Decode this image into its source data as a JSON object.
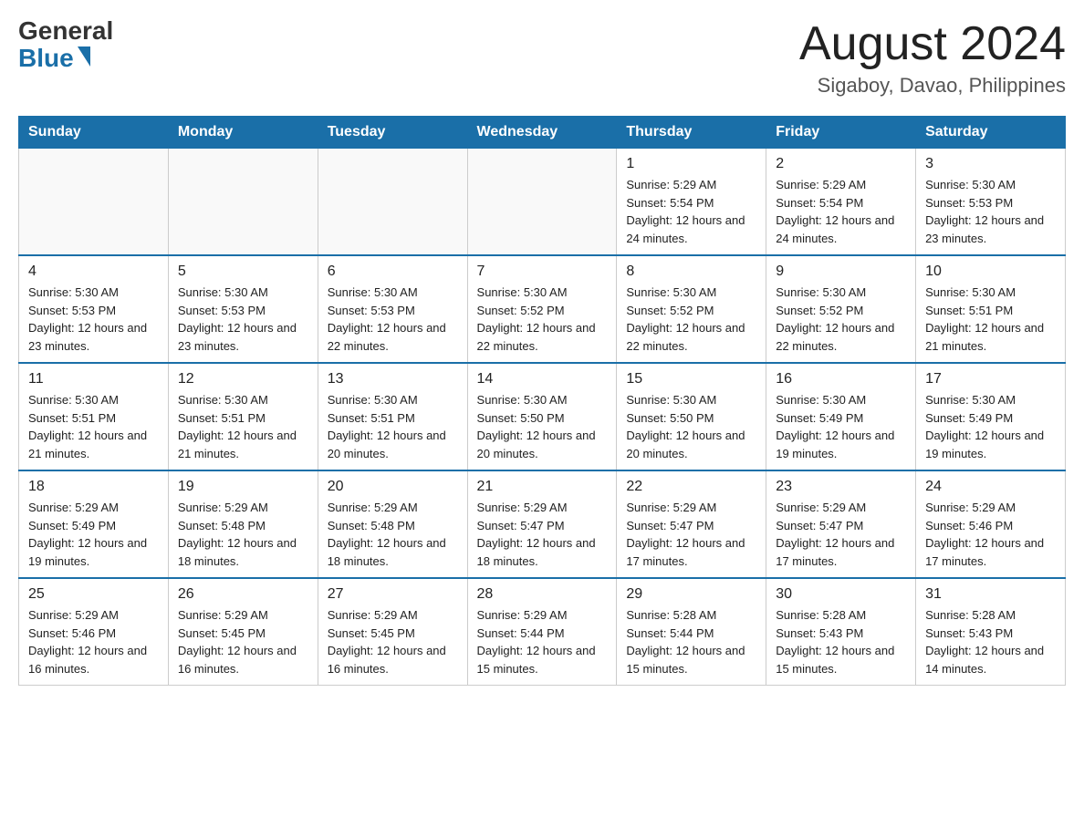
{
  "logo": {
    "general": "General",
    "blue": "Blue"
  },
  "title": {
    "month": "August 2024",
    "location": "Sigaboy, Davao, Philippines"
  },
  "weekdays": [
    "Sunday",
    "Monday",
    "Tuesday",
    "Wednesday",
    "Thursday",
    "Friday",
    "Saturday"
  ],
  "weeks": [
    [
      {
        "day": "",
        "info": ""
      },
      {
        "day": "",
        "info": ""
      },
      {
        "day": "",
        "info": ""
      },
      {
        "day": "",
        "info": ""
      },
      {
        "day": "1",
        "info": "Sunrise: 5:29 AM\nSunset: 5:54 PM\nDaylight: 12 hours and 24 minutes."
      },
      {
        "day": "2",
        "info": "Sunrise: 5:29 AM\nSunset: 5:54 PM\nDaylight: 12 hours and 24 minutes."
      },
      {
        "day": "3",
        "info": "Sunrise: 5:30 AM\nSunset: 5:53 PM\nDaylight: 12 hours and 23 minutes."
      }
    ],
    [
      {
        "day": "4",
        "info": "Sunrise: 5:30 AM\nSunset: 5:53 PM\nDaylight: 12 hours and 23 minutes."
      },
      {
        "day": "5",
        "info": "Sunrise: 5:30 AM\nSunset: 5:53 PM\nDaylight: 12 hours and 23 minutes."
      },
      {
        "day": "6",
        "info": "Sunrise: 5:30 AM\nSunset: 5:53 PM\nDaylight: 12 hours and 22 minutes."
      },
      {
        "day": "7",
        "info": "Sunrise: 5:30 AM\nSunset: 5:52 PM\nDaylight: 12 hours and 22 minutes."
      },
      {
        "day": "8",
        "info": "Sunrise: 5:30 AM\nSunset: 5:52 PM\nDaylight: 12 hours and 22 minutes."
      },
      {
        "day": "9",
        "info": "Sunrise: 5:30 AM\nSunset: 5:52 PM\nDaylight: 12 hours and 22 minutes."
      },
      {
        "day": "10",
        "info": "Sunrise: 5:30 AM\nSunset: 5:51 PM\nDaylight: 12 hours and 21 minutes."
      }
    ],
    [
      {
        "day": "11",
        "info": "Sunrise: 5:30 AM\nSunset: 5:51 PM\nDaylight: 12 hours and 21 minutes."
      },
      {
        "day": "12",
        "info": "Sunrise: 5:30 AM\nSunset: 5:51 PM\nDaylight: 12 hours and 21 minutes."
      },
      {
        "day": "13",
        "info": "Sunrise: 5:30 AM\nSunset: 5:51 PM\nDaylight: 12 hours and 20 minutes."
      },
      {
        "day": "14",
        "info": "Sunrise: 5:30 AM\nSunset: 5:50 PM\nDaylight: 12 hours and 20 minutes."
      },
      {
        "day": "15",
        "info": "Sunrise: 5:30 AM\nSunset: 5:50 PM\nDaylight: 12 hours and 20 minutes."
      },
      {
        "day": "16",
        "info": "Sunrise: 5:30 AM\nSunset: 5:49 PM\nDaylight: 12 hours and 19 minutes."
      },
      {
        "day": "17",
        "info": "Sunrise: 5:30 AM\nSunset: 5:49 PM\nDaylight: 12 hours and 19 minutes."
      }
    ],
    [
      {
        "day": "18",
        "info": "Sunrise: 5:29 AM\nSunset: 5:49 PM\nDaylight: 12 hours and 19 minutes."
      },
      {
        "day": "19",
        "info": "Sunrise: 5:29 AM\nSunset: 5:48 PM\nDaylight: 12 hours and 18 minutes."
      },
      {
        "day": "20",
        "info": "Sunrise: 5:29 AM\nSunset: 5:48 PM\nDaylight: 12 hours and 18 minutes."
      },
      {
        "day": "21",
        "info": "Sunrise: 5:29 AM\nSunset: 5:47 PM\nDaylight: 12 hours and 18 minutes."
      },
      {
        "day": "22",
        "info": "Sunrise: 5:29 AM\nSunset: 5:47 PM\nDaylight: 12 hours and 17 minutes."
      },
      {
        "day": "23",
        "info": "Sunrise: 5:29 AM\nSunset: 5:47 PM\nDaylight: 12 hours and 17 minutes."
      },
      {
        "day": "24",
        "info": "Sunrise: 5:29 AM\nSunset: 5:46 PM\nDaylight: 12 hours and 17 minutes."
      }
    ],
    [
      {
        "day": "25",
        "info": "Sunrise: 5:29 AM\nSunset: 5:46 PM\nDaylight: 12 hours and 16 minutes."
      },
      {
        "day": "26",
        "info": "Sunrise: 5:29 AM\nSunset: 5:45 PM\nDaylight: 12 hours and 16 minutes."
      },
      {
        "day": "27",
        "info": "Sunrise: 5:29 AM\nSunset: 5:45 PM\nDaylight: 12 hours and 16 minutes."
      },
      {
        "day": "28",
        "info": "Sunrise: 5:29 AM\nSunset: 5:44 PM\nDaylight: 12 hours and 15 minutes."
      },
      {
        "day": "29",
        "info": "Sunrise: 5:28 AM\nSunset: 5:44 PM\nDaylight: 12 hours and 15 minutes."
      },
      {
        "day": "30",
        "info": "Sunrise: 5:28 AM\nSunset: 5:43 PM\nDaylight: 12 hours and 15 minutes."
      },
      {
        "day": "31",
        "info": "Sunrise: 5:28 AM\nSunset: 5:43 PM\nDaylight: 12 hours and 14 minutes."
      }
    ]
  ]
}
